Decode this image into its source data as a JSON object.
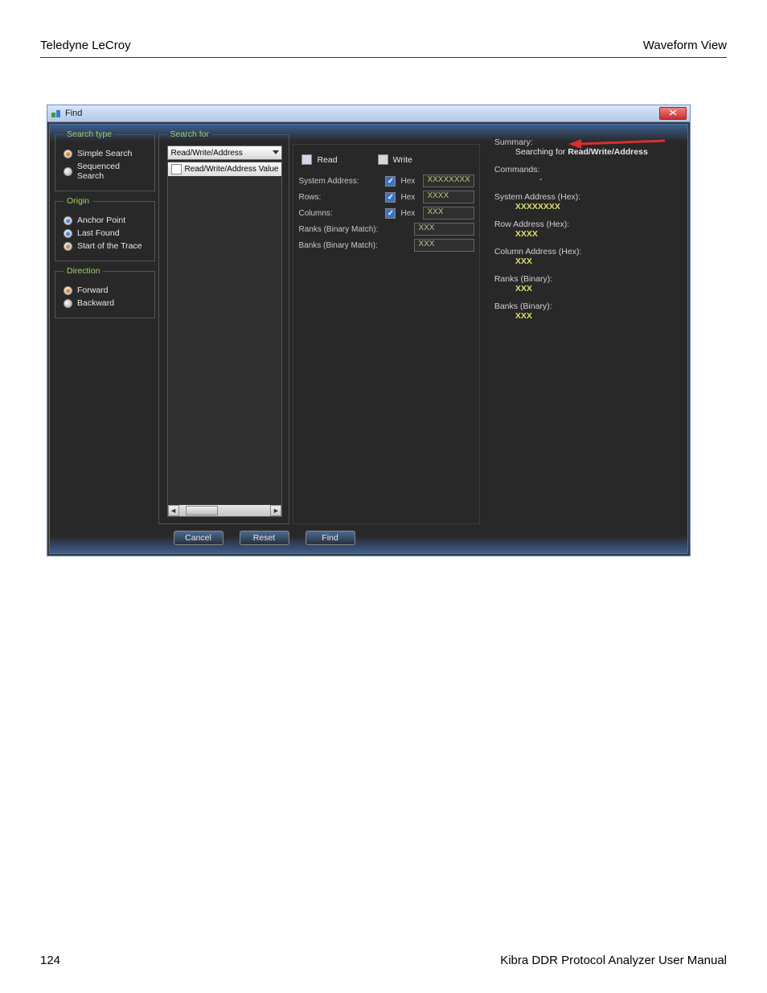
{
  "page": {
    "header_left": "Teledyne LeCroy",
    "header_right": "Waveform View",
    "footer_left": "124",
    "footer_right": "Kibra DDR Protocol Analyzer User Manual"
  },
  "window": {
    "title": "Find"
  },
  "search_type": {
    "legend": "Search type",
    "options": [
      {
        "label": "Simple Search",
        "selected": true
      },
      {
        "label": "Sequenced Search",
        "selected": false
      }
    ]
  },
  "origin": {
    "legend": "Origin",
    "options": [
      {
        "label": "Anchor Point",
        "selected": false,
        "style": "blue"
      },
      {
        "label": "Last Found",
        "selected": false,
        "style": "blue"
      },
      {
        "label": "Start of the Trace",
        "selected": true,
        "style": "orange"
      }
    ]
  },
  "direction": {
    "legend": "Direction",
    "options": [
      {
        "label": "Forward",
        "selected": true
      },
      {
        "label": "Backward",
        "selected": false
      }
    ]
  },
  "search_for": {
    "legend": "Search for",
    "dropdown": "Read/Write/Address",
    "list_selected": "Read/Write/Address Value"
  },
  "form": {
    "read": {
      "label": "Read",
      "checked": false
    },
    "write": {
      "label": "Write",
      "checked": false
    },
    "rows": [
      {
        "label": "System Address:",
        "hex_checked": true,
        "hex_label": "Hex",
        "value": "XXXXXXXX"
      },
      {
        "label": "Rows:",
        "hex_checked": true,
        "hex_label": "Hex",
        "value": "XXXX"
      },
      {
        "label": "Columns:",
        "hex_checked": true,
        "hex_label": "Hex",
        "value": "XXX"
      },
      {
        "label": "Ranks (Binary Match):",
        "value": "XXX"
      },
      {
        "label": "Banks (Binary Match):",
        "value": "XXX"
      }
    ]
  },
  "summary": {
    "title": "Summary:",
    "searching_prefix": "Searching for ",
    "searching_for": "Read/Write/Address",
    "commands_label": "Commands:",
    "commands_value": "-",
    "items": [
      {
        "label": "System Address (Hex):",
        "value": "XXXXXXXX"
      },
      {
        "label": "Row Address (Hex):",
        "value": "XXXX"
      },
      {
        "label": "Column Address (Hex):",
        "value": "XXX"
      },
      {
        "label": "Ranks (Binary):",
        "value": "XXX"
      },
      {
        "label": "Banks (Binary):",
        "value": "XXX"
      }
    ]
  },
  "buttons": {
    "cancel": "Cancel",
    "reset": "Reset",
    "find": "Find"
  }
}
